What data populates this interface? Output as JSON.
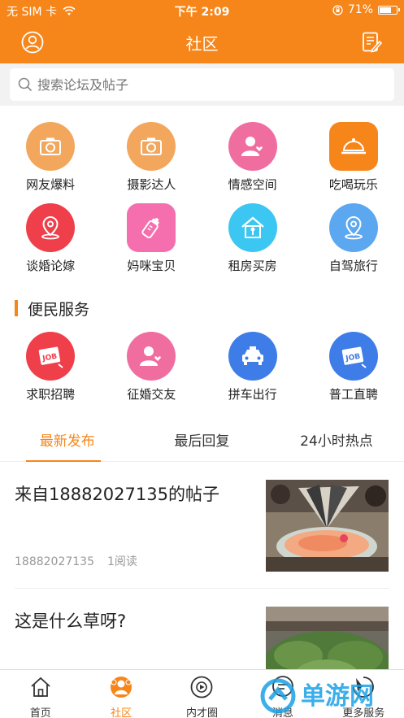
{
  "status_bar": {
    "carrier": "无 SIM 卡",
    "time": "下午 2:09",
    "battery": "71%",
    "battery_level": 0.71
  },
  "header": {
    "title": "社区"
  },
  "search": {
    "placeholder": "搜索论坛及帖子"
  },
  "categories": [
    {
      "label": "网友爆料",
      "icon": "camera-icon",
      "color": "#f2a75c"
    },
    {
      "label": "摄影达人",
      "icon": "camera-icon",
      "color": "#f2a75c"
    },
    {
      "label": "情感空间",
      "icon": "heart-person-icon",
      "color": "#f06da0"
    },
    {
      "label": "吃喝玩乐",
      "icon": "food-cloche-icon",
      "color": "#f7861a"
    },
    {
      "label": "谈婚论嫁",
      "icon": "location-pin-icon",
      "color": "#ef3f4a"
    },
    {
      "label": "妈咪宝贝",
      "icon": "baby-bottle-icon",
      "color": "#f56fae"
    },
    {
      "label": "租房买房",
      "icon": "house-key-icon",
      "color": "#3cc6f2"
    },
    {
      "label": "自驾旅行",
      "icon": "location-pin-icon",
      "color": "#5ba7f0"
    }
  ],
  "services_title": "便民服务",
  "services": [
    {
      "label": "求职招聘",
      "icon": "job-icon",
      "color": "#ef3f4a",
      "badge": "JOB"
    },
    {
      "label": "征婚交友",
      "icon": "heart-person-icon",
      "color": "#f06da0",
      "badge": ""
    },
    {
      "label": "拼车出行",
      "icon": "taxi-icon",
      "color": "#3e7de8",
      "badge": ""
    },
    {
      "label": "普工直聘",
      "icon": "job-icon",
      "color": "#3e7de8",
      "badge": "JOB"
    }
  ],
  "tabs": [
    {
      "label": "最新发布",
      "active": true
    },
    {
      "label": "最后回复",
      "active": false
    },
    {
      "label": "24小时热点",
      "active": false
    }
  ],
  "posts": [
    {
      "title": "来自18882027135的帖子",
      "author": "18882027135",
      "reads": "1阅读"
    },
    {
      "title": "这是什么草呀?",
      "author": "",
      "reads": ""
    }
  ],
  "tabbar": [
    {
      "label": "首页",
      "icon": "home-icon",
      "active": false
    },
    {
      "label": "社区",
      "icon": "community-icon",
      "active": true
    },
    {
      "label": "内才圈",
      "icon": "circle-icon",
      "active": false
    },
    {
      "label": "消息",
      "icon": "message-icon",
      "active": false
    },
    {
      "label": "更多服务",
      "icon": "more-services-icon",
      "active": false
    }
  ],
  "watermark": {
    "text": "单游网"
  },
  "colors": {
    "brand": "#f7861a"
  }
}
